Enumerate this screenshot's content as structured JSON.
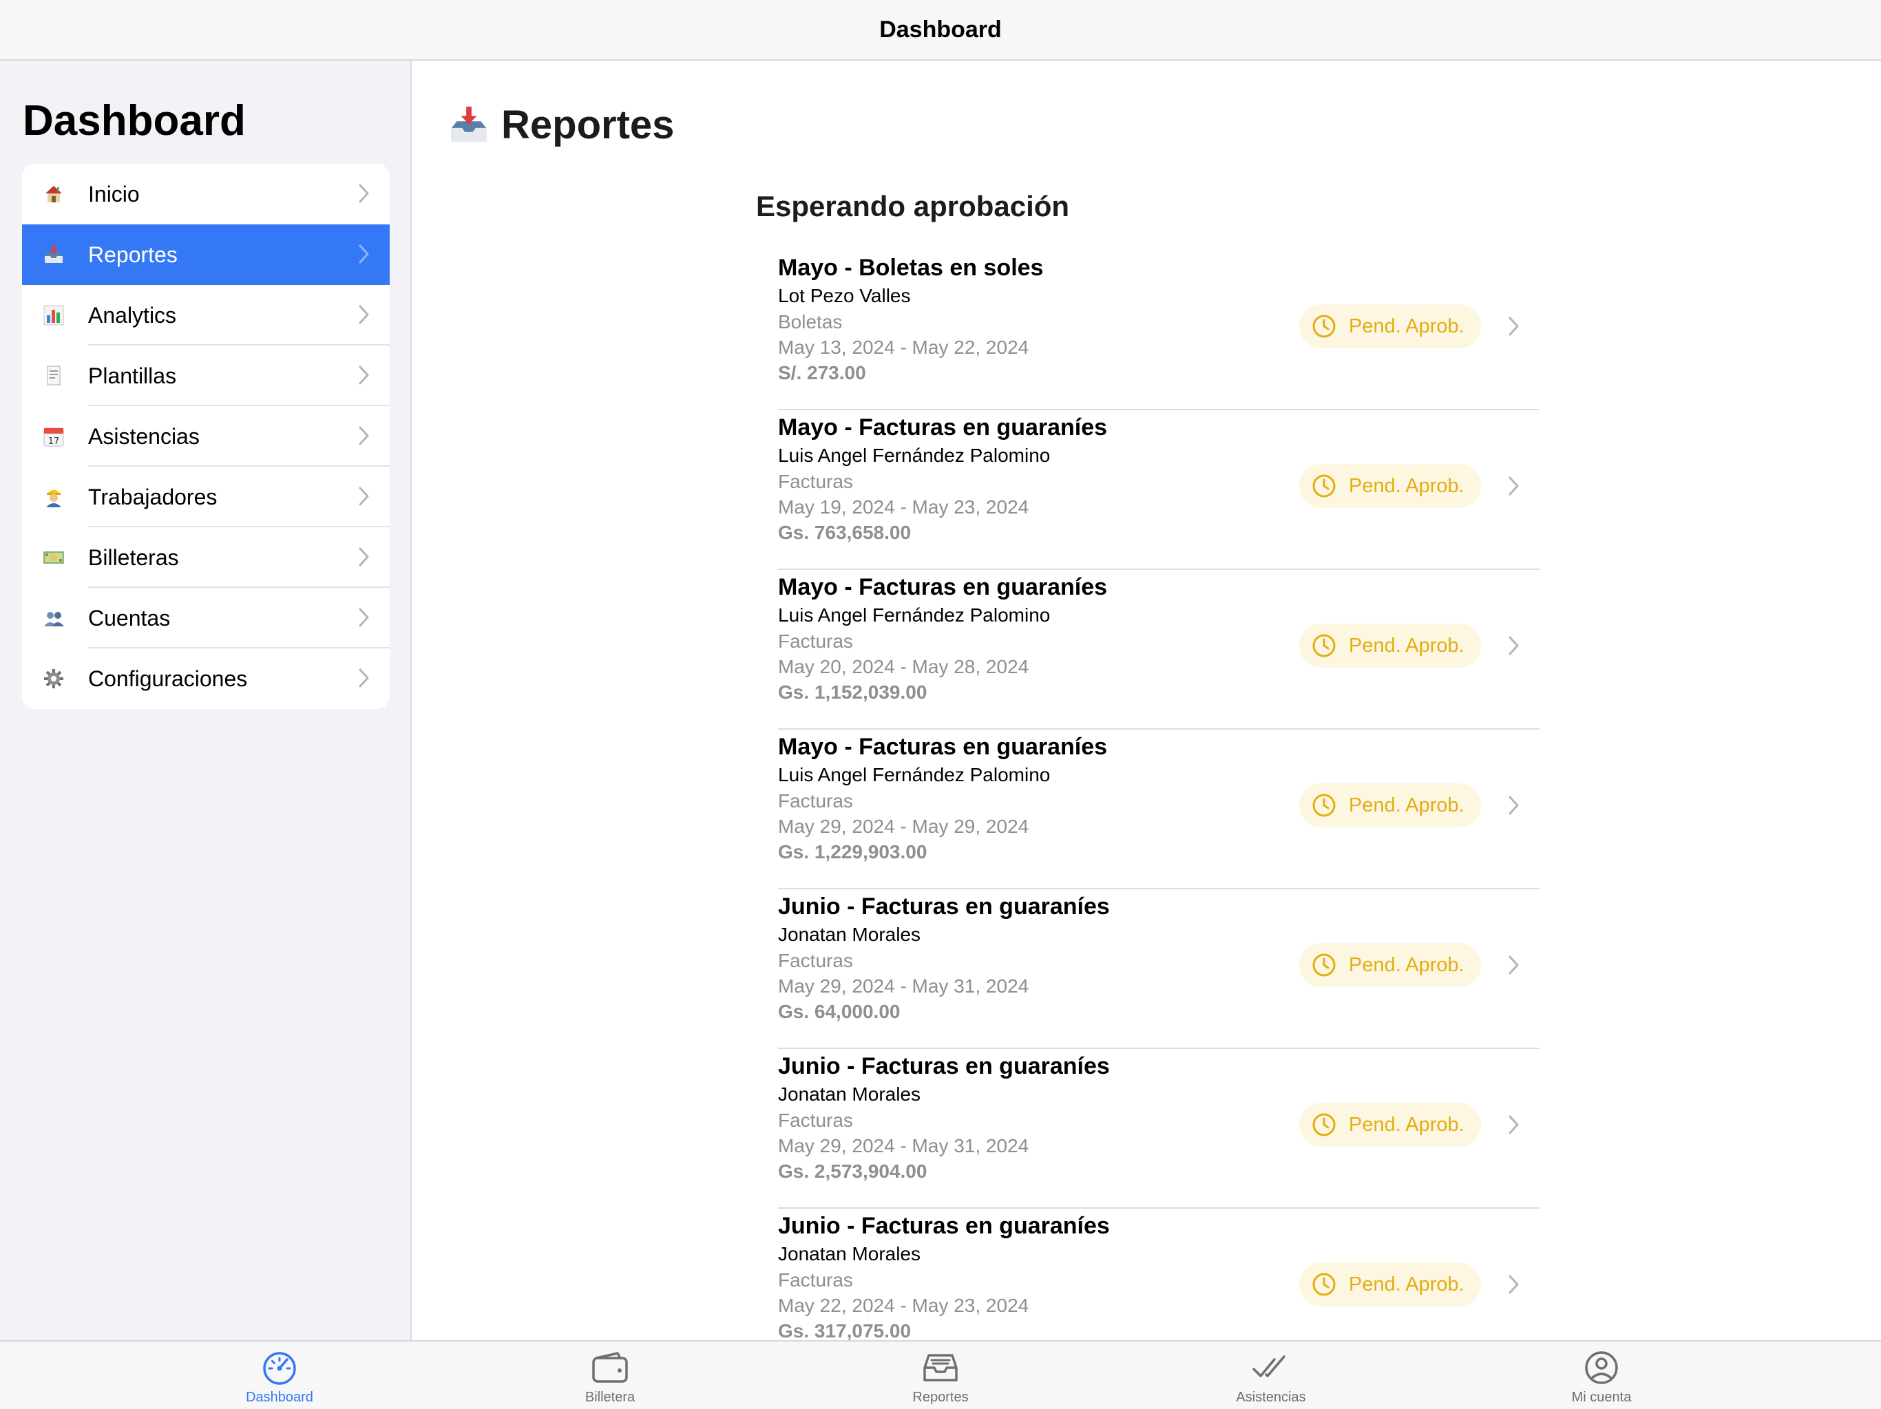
{
  "topbar": {
    "title": "Dashboard"
  },
  "sidebar": {
    "title": "Dashboard",
    "items": [
      {
        "label": "Inicio",
        "icon": "house-icon",
        "active": false
      },
      {
        "label": "Reportes",
        "icon": "inbox-tray-icon",
        "active": true
      },
      {
        "label": "Analytics",
        "icon": "bar-chart-icon",
        "active": false
      },
      {
        "label": "Plantillas",
        "icon": "receipt-icon",
        "active": false
      },
      {
        "label": "Asistencias",
        "icon": "calendar-icon",
        "active": false
      },
      {
        "label": "Trabajadores",
        "icon": "worker-icon",
        "active": false
      },
      {
        "label": "Billeteras",
        "icon": "money-icon",
        "active": false
      },
      {
        "label": "Cuentas",
        "icon": "people-icon",
        "active": false
      },
      {
        "label": "Configuraciones",
        "icon": "gear-icon",
        "active": false
      }
    ],
    "calendar_day": "17"
  },
  "main": {
    "title": "Reportes",
    "section_title": "Esperando aprobación",
    "reports": [
      {
        "title": "Mayo - Boletas en soles",
        "person": "Lot Pezo Valles",
        "type": "Boletas",
        "dates": "May 13, 2024 - May 22, 2024",
        "amount": "S/. 273.00",
        "status": "Pend. Aprob."
      },
      {
        "title": "Mayo - Facturas en guaraníes",
        "person": "Luis Angel Fernández Palomino",
        "type": "Facturas",
        "dates": "May 19, 2024 - May 23, 2024",
        "amount": "Gs. 763,658.00",
        "status": "Pend. Aprob."
      },
      {
        "title": "Mayo - Facturas en guaraníes",
        "person": "Luis Angel Fernández Palomino",
        "type": "Facturas",
        "dates": "May 20, 2024 - May 28, 2024",
        "amount": "Gs. 1,152,039.00",
        "status": "Pend. Aprob."
      },
      {
        "title": "Mayo - Facturas en guaraníes",
        "person": "Luis Angel Fernández Palomino",
        "type": "Facturas",
        "dates": "May 29, 2024 - May 29, 2024",
        "amount": "Gs. 1,229,903.00",
        "status": "Pend. Aprob."
      },
      {
        "title": "Junio - Facturas en guaraníes",
        "person": "Jonatan Morales",
        "type": "Facturas",
        "dates": "May 29, 2024 - May 31, 2024",
        "amount": "Gs. 64,000.00",
        "status": "Pend. Aprob."
      },
      {
        "title": "Junio - Facturas en guaraníes",
        "person": "Jonatan Morales",
        "type": "Facturas",
        "dates": "May 29, 2024 - May 31, 2024",
        "amount": "Gs. 2,573,904.00",
        "status": "Pend. Aprob."
      },
      {
        "title": "Junio - Facturas en guaraníes",
        "person": "Jonatan Morales",
        "type": "Facturas",
        "dates": "May 22, 2024 - May 23, 2024",
        "amount": "Gs. 317,075.00",
        "status": "Pend. Aprob."
      }
    ]
  },
  "tabbar": {
    "tabs": [
      {
        "label": "Dashboard",
        "icon": "speedometer-icon",
        "active": true
      },
      {
        "label": "Billetera",
        "icon": "wallet-icon",
        "active": false
      },
      {
        "label": "Reportes",
        "icon": "tray-icon",
        "active": false
      },
      {
        "label": "Asistencias",
        "icon": "double-check-icon",
        "active": false
      },
      {
        "label": "Mi cuenta",
        "icon": "person-circle-icon",
        "active": false
      }
    ]
  },
  "colors": {
    "accent": "#3478f6",
    "pending": "#e4ad16",
    "pending_bg": "#fdf6e0",
    "sidebar_bg": "#f2f2f7",
    "secondary_text": "#8e8e93"
  }
}
